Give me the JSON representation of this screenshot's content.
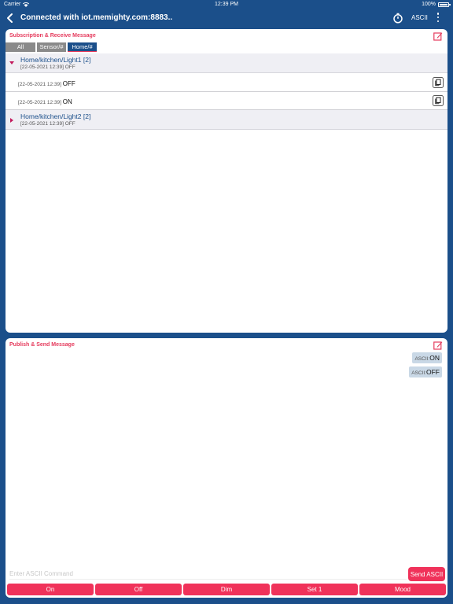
{
  "status_bar": {
    "carrier": "Carrier",
    "time": "12:39 PM",
    "battery": "100%"
  },
  "nav": {
    "title": "Connected with iot.memighty.com:8883..",
    "mode_label": "ASCII",
    "icons": [
      "back-chevron-icon",
      "timer-icon",
      "more-vertical-icon"
    ]
  },
  "subscription": {
    "title": "Subscription & Receive Message",
    "filters": [
      "All",
      "Sensor/#",
      "Home/#"
    ],
    "selected_filter": "Home/#",
    "groups": [
      {
        "topic": "Home/kitchen/Light1 [2]",
        "last": "[22-05-2021 12:39] OFF",
        "expanded": true,
        "messages": [
          {
            "timestamp": "[22-05-2021 12:39]",
            "value": "OFF"
          },
          {
            "timestamp": "[22-05-2021 12:39]",
            "value": "ON"
          }
        ]
      },
      {
        "topic": "Home/kitchen/Light2 [2]",
        "last": "[22-05-2021 12:39] OFF",
        "expanded": false,
        "messages": []
      }
    ]
  },
  "publish": {
    "title": "Publish & Send Message",
    "sent": [
      {
        "prefix": "ASCII:",
        "value": "ON"
      },
      {
        "prefix": "ASCII:",
        "value": "OFF"
      }
    ],
    "input_placeholder": "Enter ASCII Command",
    "input_value": "",
    "send_label": "Send ASCII",
    "quick_buttons": [
      "On",
      "Off",
      "Dim",
      "Set 1",
      "Mood"
    ]
  },
  "colors": {
    "brand": "#1b4f8a",
    "accent": "#f0325a",
    "title_red": "#e53a5c"
  }
}
